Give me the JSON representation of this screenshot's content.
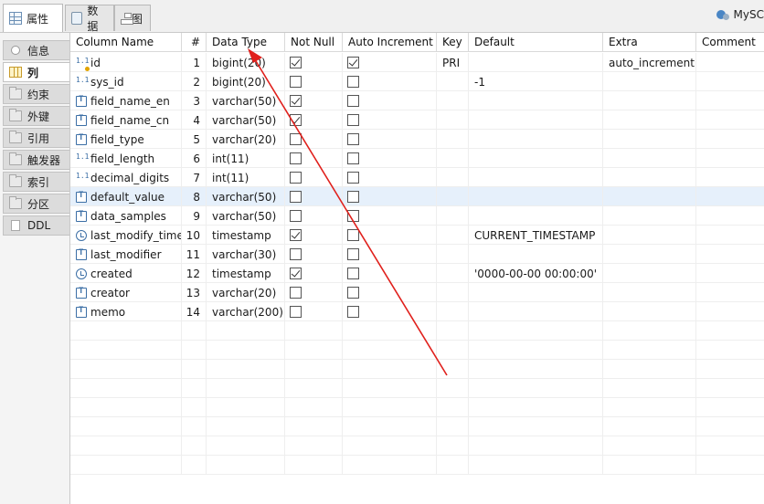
{
  "tabs": [
    {
      "label": "属性",
      "icon": "table-grid-icon",
      "active": true
    },
    {
      "label": "数据",
      "icon": "document-icon",
      "active": false
    },
    {
      "label": "图",
      "icon": "diagram-icon",
      "active": false
    }
  ],
  "connection_label": "MySC",
  "sidebar": {
    "items": [
      {
        "label": "信息",
        "icon": "lightbulb-icon"
      },
      {
        "label": "列",
        "icon": "columns-icon",
        "active": true
      },
      {
        "label": "约束",
        "icon": "folder-icon"
      },
      {
        "label": "外键",
        "icon": "folder-icon"
      },
      {
        "label": "引用",
        "icon": "folder-icon"
      },
      {
        "label": "触发器",
        "icon": "folder-icon"
      },
      {
        "label": "索引",
        "icon": "folder-icon"
      },
      {
        "label": "分区",
        "icon": "folder-icon"
      },
      {
        "label": "DDL",
        "icon": "page-icon"
      }
    ]
  },
  "columns_table": {
    "headers": [
      "Column Name",
      "#",
      "Data Type",
      "Not Null",
      "Auto Increment",
      "Key",
      "Default",
      "Extra",
      "Comment"
    ],
    "rows": [
      {
        "name": "id",
        "num": "1",
        "type": "bigint(20)",
        "not_null": true,
        "auto_inc": true,
        "key": "PRI",
        "default": "",
        "extra": "auto_increment",
        "comment": "",
        "icon": "numeric-key-icon"
      },
      {
        "name": "sys_id",
        "num": "2",
        "type": "bigint(20)",
        "not_null": false,
        "auto_inc": false,
        "key": "",
        "default": "-1",
        "extra": "",
        "comment": "",
        "icon": "numeric-icon"
      },
      {
        "name": "field_name_en",
        "num": "3",
        "type": "varchar(50)",
        "not_null": true,
        "auto_inc": false,
        "key": "",
        "default": "",
        "extra": "",
        "comment": "",
        "icon": "text-icon"
      },
      {
        "name": "field_name_cn",
        "num": "4",
        "type": "varchar(50)",
        "not_null": true,
        "auto_inc": false,
        "key": "",
        "default": "",
        "extra": "",
        "comment": "",
        "icon": "text-icon"
      },
      {
        "name": "field_type",
        "num": "5",
        "type": "varchar(20)",
        "not_null": false,
        "auto_inc": false,
        "key": "",
        "default": "",
        "extra": "",
        "comment": "",
        "icon": "text-icon"
      },
      {
        "name": "field_length",
        "num": "6",
        "type": "int(11)",
        "not_null": false,
        "auto_inc": false,
        "key": "",
        "default": "",
        "extra": "",
        "comment": "",
        "icon": "numeric-icon"
      },
      {
        "name": "decimal_digits",
        "num": "7",
        "type": "int(11)",
        "not_null": false,
        "auto_inc": false,
        "key": "",
        "default": "",
        "extra": "",
        "comment": "",
        "icon": "numeric-icon"
      },
      {
        "name": "default_value",
        "num": "8",
        "type": "varchar(50)",
        "not_null": false,
        "auto_inc": false,
        "key": "",
        "default": "",
        "extra": "",
        "comment": "",
        "icon": "text-icon",
        "selected": true
      },
      {
        "name": "data_samples",
        "num": "9",
        "type": "varchar(50)",
        "not_null": false,
        "auto_inc": false,
        "key": "",
        "default": "",
        "extra": "",
        "comment": "",
        "icon": "text-icon"
      },
      {
        "name": "last_modify_time",
        "num": "10",
        "type": "timestamp",
        "not_null": true,
        "auto_inc": false,
        "key": "",
        "default": "CURRENT_TIMESTAMP",
        "extra": "",
        "comment": "",
        "icon": "datetime-icon"
      },
      {
        "name": "last_modifier",
        "num": "11",
        "type": "varchar(30)",
        "not_null": false,
        "auto_inc": false,
        "key": "",
        "default": "",
        "extra": "",
        "comment": "",
        "icon": "text-icon"
      },
      {
        "name": "created",
        "num": "12",
        "type": "timestamp",
        "not_null": true,
        "auto_inc": false,
        "key": "",
        "default": "'0000-00-00 00:00:00'",
        "extra": "",
        "comment": "",
        "icon": "datetime-icon"
      },
      {
        "name": "creator",
        "num": "13",
        "type": "varchar(20)",
        "not_null": false,
        "auto_inc": false,
        "key": "",
        "default": "",
        "extra": "",
        "comment": "",
        "icon": "text-icon"
      },
      {
        "name": "memo",
        "num": "14",
        "type": "varchar(200)",
        "not_null": false,
        "auto_inc": false,
        "key": "",
        "default": "",
        "extra": "",
        "comment": "",
        "icon": "text-icon"
      }
    ]
  },
  "colors": {
    "annotation_arrow": "#e0201c",
    "selected_row": "#e6f0fb"
  }
}
